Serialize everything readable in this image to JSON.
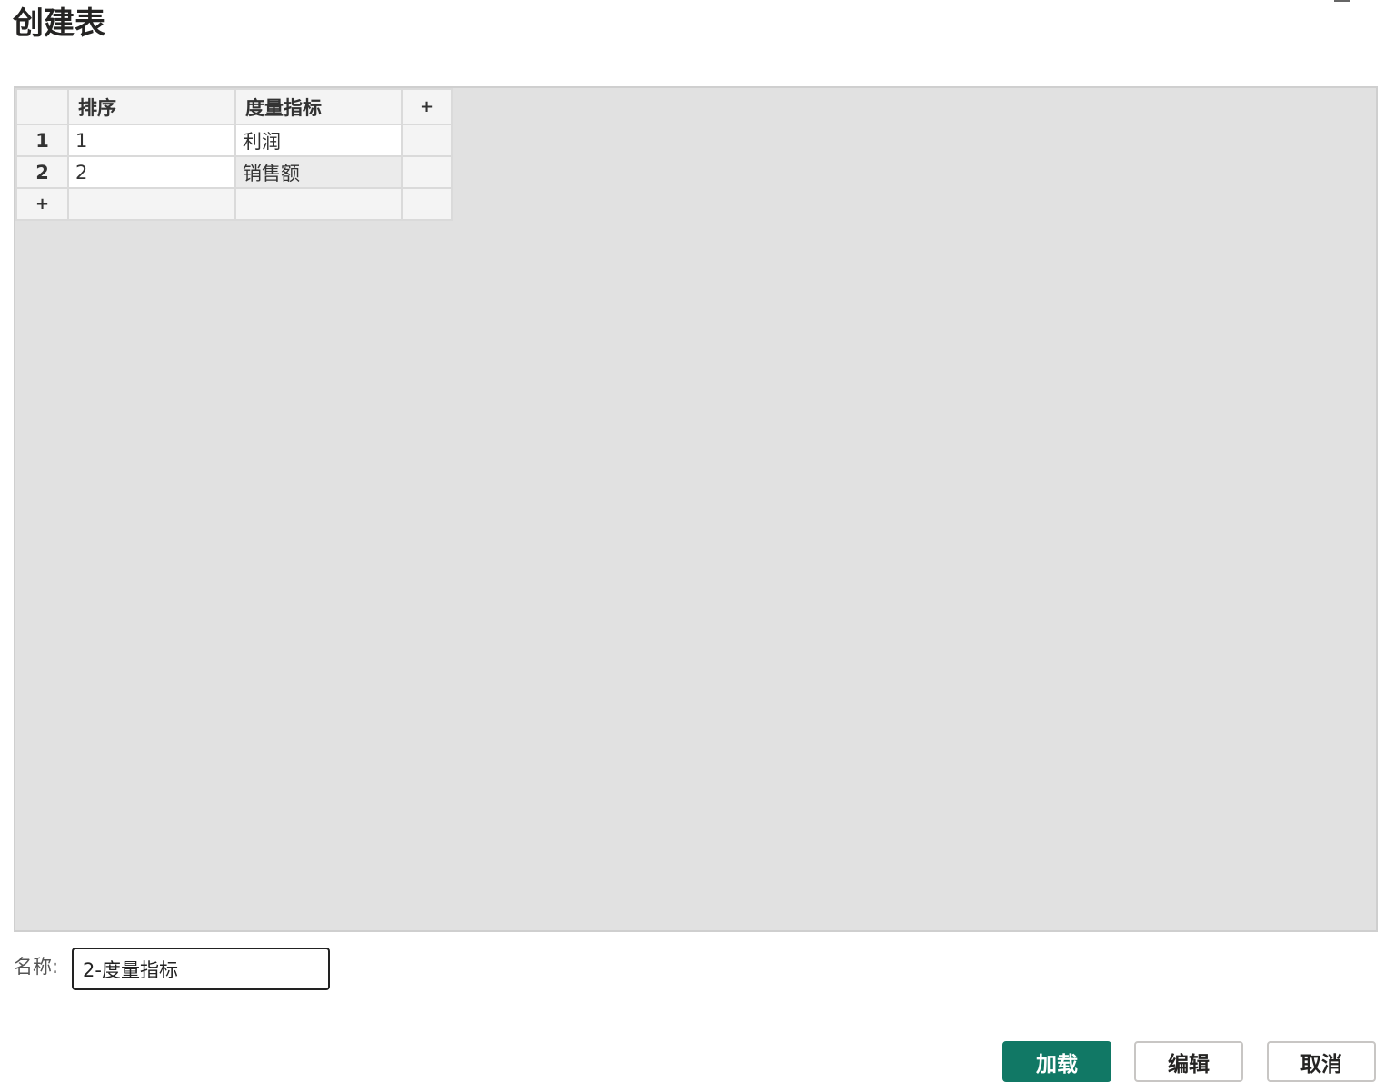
{
  "dialog": {
    "title": "创建表"
  },
  "grid": {
    "add_column_label": "+",
    "add_row_label": "+",
    "columns": [
      "排序",
      "度量指标"
    ],
    "rows": [
      {
        "num": "1",
        "cells": [
          "1",
          "利润"
        ]
      },
      {
        "num": "2",
        "cells": [
          "2",
          "销售额"
        ]
      }
    ]
  },
  "name_field": {
    "label": "名称:",
    "value": "2-度量指标"
  },
  "buttons": {
    "load": "加载",
    "edit": "编辑",
    "cancel": "取消"
  },
  "colors": {
    "primary": "#117865",
    "grid_background": "#e1e1e1"
  }
}
